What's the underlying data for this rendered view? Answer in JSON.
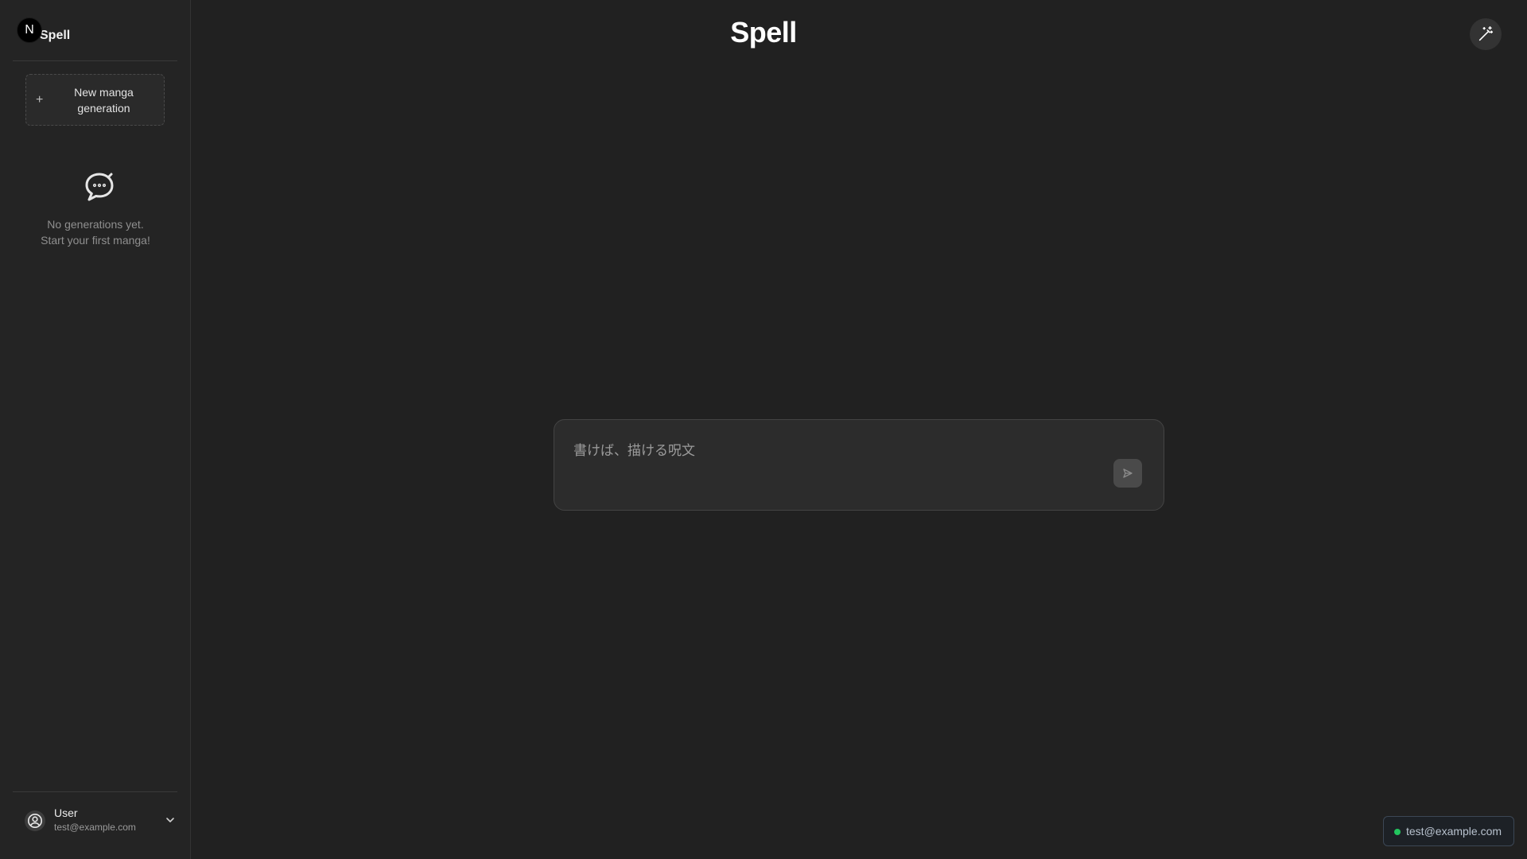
{
  "sidebar": {
    "title": "Spell",
    "badge_letter": "N",
    "new_button": {
      "icon": "plus-icon",
      "label": "New manga generation"
    },
    "empty_state": {
      "icon": "speech-bubble-icon",
      "line1": "No generations yet.",
      "line2": "Start your first manga!"
    },
    "user": {
      "icon": "user-circle-icon",
      "name": "User",
      "email": "test@example.com",
      "menu_icon": "chevron-down-icon"
    }
  },
  "header": {
    "title": "Spell",
    "magic_icon": "magic-wand-icon"
  },
  "prompt": {
    "placeholder": "書けば、描ける呪文",
    "value": "",
    "send_icon": "send-icon"
  },
  "status": {
    "email": "test@example.com",
    "dot_color": "#22c55e"
  },
  "colors": {
    "background": "#212121",
    "sidebar": "#242424",
    "accent_status": "#22c55e"
  }
}
